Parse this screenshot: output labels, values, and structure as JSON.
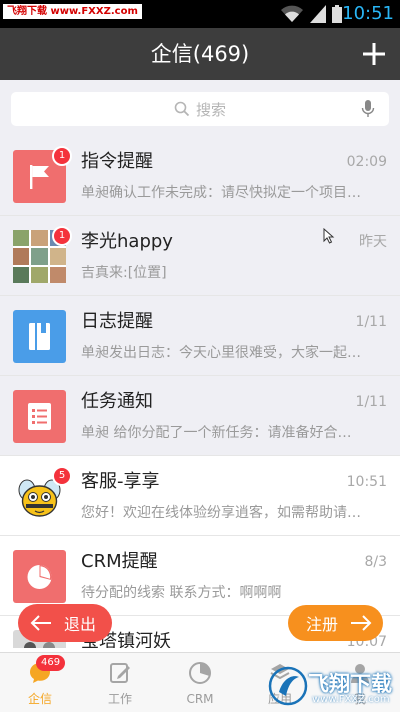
{
  "status_bar": {
    "watermark": "飞翔下载 www.FXXZ.com",
    "time": "10:51"
  },
  "header": {
    "title": "企信(469)",
    "add_icon": "plus-icon"
  },
  "search": {
    "placeholder": "搜索",
    "search_icon": "search-icon",
    "mic_icon": "microphone-icon"
  },
  "messages": [
    {
      "title": "指令提醒",
      "subtitle": "单昶确认工作未完成：请尽快拟定一个项目…",
      "time": "02:09",
      "badge": "1",
      "icon": "flag-icon",
      "color": "#f06e6e"
    },
    {
      "title": "李光happy",
      "subtitle": "吉真来:[位置]",
      "time": "昨天",
      "badge": "1",
      "icon": "photo-mosaic-avatar"
    },
    {
      "title": "日志提醒",
      "subtitle": "单昶发出日志：今天心里很难受，大家一起…",
      "time": "1/11",
      "badge": "",
      "icon": "notebook-icon",
      "color": "#4a9de8"
    },
    {
      "title": "任务通知",
      "subtitle": "单昶 给你分配了一个新任务：请准备好合…",
      "time": "1/11",
      "badge": "",
      "icon": "task-list-icon",
      "color": "#f06e6e"
    },
    {
      "title": "客服-享享",
      "subtitle": "您好！欢迎在线体验纷享逍客，如需帮助请…",
      "time": "10:51",
      "badge": "5",
      "icon": "bee-mascot-avatar"
    },
    {
      "title": "CRM提醒",
      "subtitle": "待分配的线索 联系方式：啊啊啊",
      "time": "8/3",
      "badge": "",
      "icon": "pie-chart-icon",
      "color": "#f06e6e"
    },
    {
      "title": "宝塔镇河妖",
      "subtitle": "",
      "time": "10:07",
      "badge": "",
      "icon": "group-avatar"
    }
  ],
  "floating": {
    "logout_label": "退出",
    "register_label": "注册"
  },
  "tabs": [
    {
      "label": "企信",
      "icon": "chat-bubble-icon",
      "badge": "469",
      "active": true
    },
    {
      "label": "工作",
      "icon": "edit-icon",
      "badge": "",
      "active": false
    },
    {
      "label": "CRM",
      "icon": "pie-chart-icon",
      "badge": "",
      "active": false
    },
    {
      "label": "应用",
      "icon": "apps-icon",
      "badge": "",
      "active": false
    },
    {
      "label": "我",
      "icon": "person-icon",
      "badge": "",
      "active": false
    }
  ],
  "bottom_watermark": {
    "text": "飞翔下载",
    "url": "www.FXXZ.com"
  },
  "colors": {
    "header_bg": "#3d3d3d",
    "accent_orange": "#f7901e",
    "badge_red": "#f4323c",
    "logout_red": "#f2504a"
  }
}
